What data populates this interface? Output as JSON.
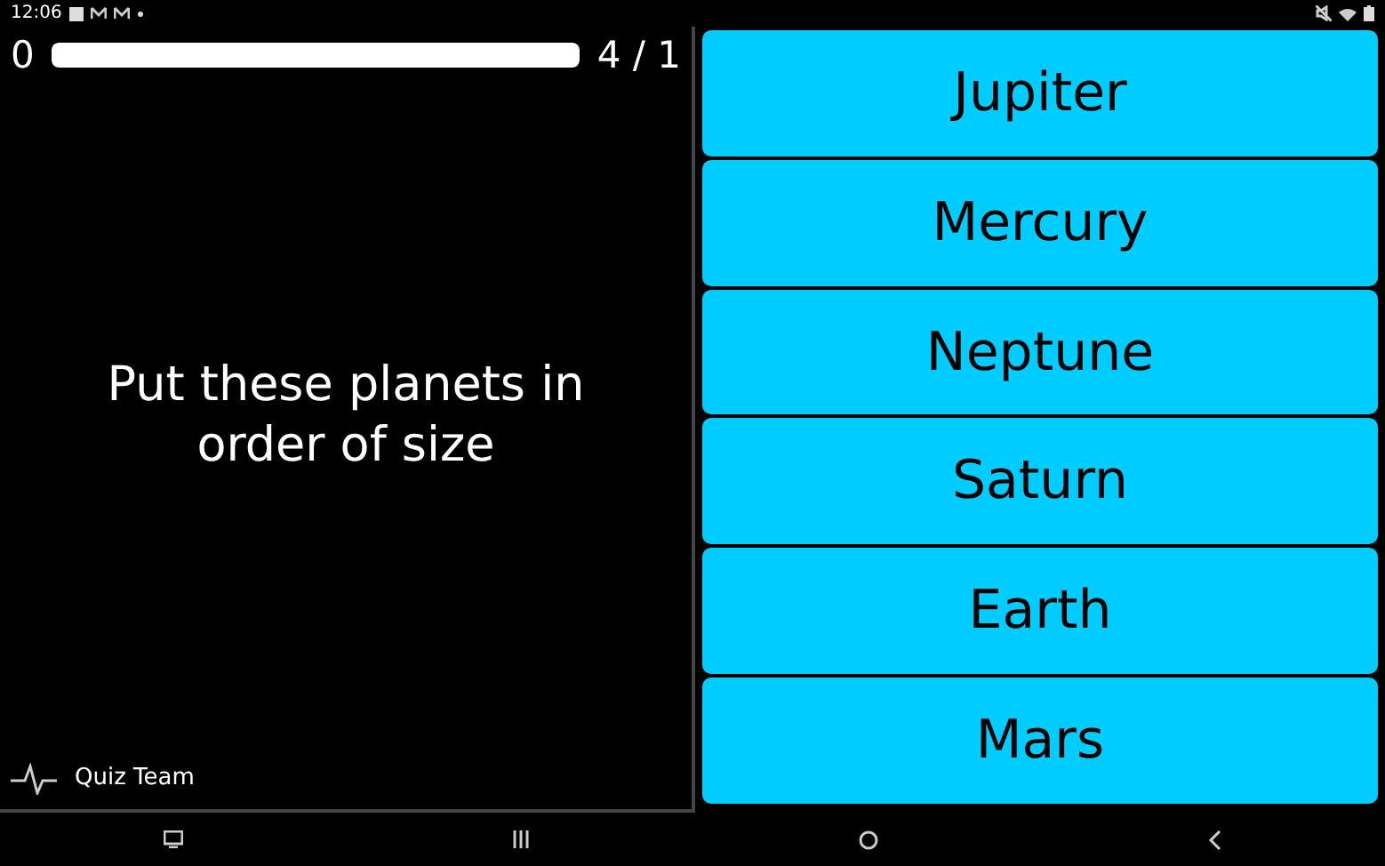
{
  "status_bar": {
    "time": "12:06"
  },
  "score": "0",
  "timer": {
    "level": 1
  },
  "progress": "4 / 1",
  "question": "Put these planets in order of size",
  "answers": [
    {
      "label": "Jupiter"
    },
    {
      "label": "Mercury"
    },
    {
      "label": "Neptune"
    },
    {
      "label": "Saturn"
    },
    {
      "label": "Earth"
    },
    {
      "label": "Mars"
    }
  ],
  "footer": {
    "author": "Quiz Team"
  }
}
